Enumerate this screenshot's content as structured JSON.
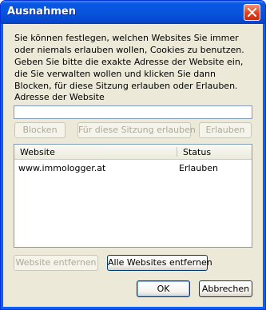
{
  "window": {
    "title": "Ausnahmen"
  },
  "intro_text": "Sie können festlegen, welchen Websites Sie immer oder niemals erlauben wollen, Cookies zu benutzen. Geben Sie bitte die exakte Adresse der Website ein, die Sie verwalten wollen und klicken Sie dann Blocken, für diese Sitzung erlauben oder Erlauben.",
  "site_field": {
    "label": "Adresse der Website",
    "value": ""
  },
  "buttons": {
    "block": "Blocken",
    "allow_session": "Für diese Sitzung erlauben",
    "allow": "Erlauben",
    "remove_site": "Website entfernen",
    "remove_all": "Alle Websites entfernen",
    "ok": "OK",
    "cancel": "Abbrechen"
  },
  "table": {
    "columns": [
      "Website",
      "Status"
    ],
    "rows": [
      {
        "site": "www.immologger.at",
        "status": "Erlauben"
      }
    ]
  }
}
